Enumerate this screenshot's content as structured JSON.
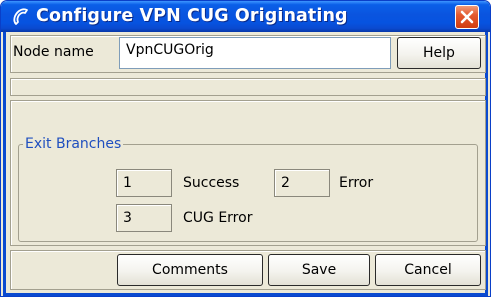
{
  "window": {
    "title": "Configure VPN CUG Originating",
    "title_icon": "phone-handset-icon",
    "close_icon": "close-x-icon"
  },
  "node": {
    "label": "Node name",
    "value": "VpnCUGOrig",
    "help_label": "Help"
  },
  "exit_branches": {
    "legend": "Exit Branches",
    "branches": [
      {
        "number": "1",
        "label": "Success"
      },
      {
        "number": "2",
        "label": "Error"
      },
      {
        "number": "3",
        "label": "CUG Error"
      }
    ]
  },
  "footer": {
    "comments_label": "Comments",
    "save_label": "Save",
    "cancel_label": "Cancel"
  },
  "colors": {
    "titlebar": "#0a54df",
    "window_bg": "#ece9d8",
    "legend_text": "#1f4fbf",
    "close_button": "#d13c10"
  }
}
